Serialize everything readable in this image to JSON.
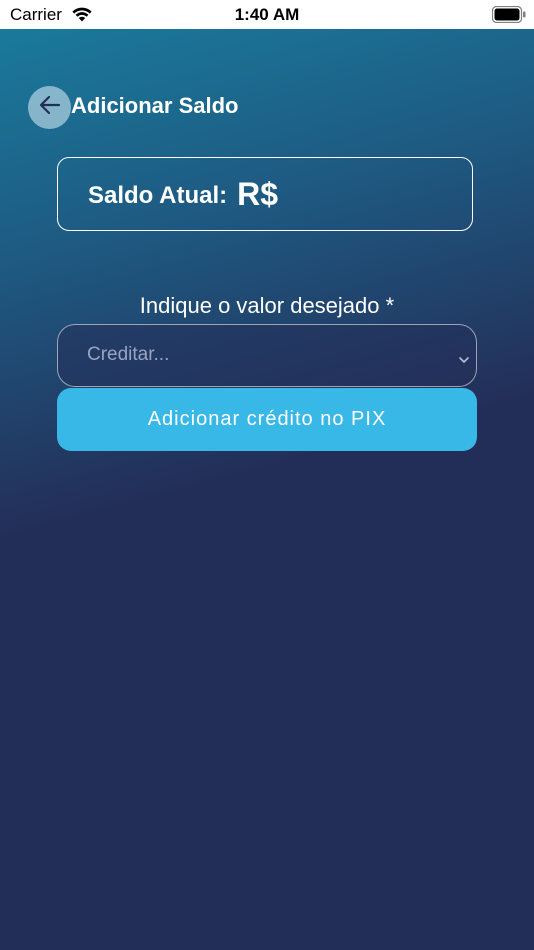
{
  "status_bar": {
    "carrier": "Carrier",
    "time": "1:40 AM",
    "wifi_icon": "wifi-icon",
    "battery_icon": "battery-icon"
  },
  "header": {
    "back_icon": "arrow-left-icon",
    "title": "Adicionar Saldo"
  },
  "balance": {
    "label": "Saldo Atual:",
    "value": "R$"
  },
  "form": {
    "field_label": "Indique o valor desejado *",
    "select_placeholder": "Creditar...",
    "select_icon": "chevron-down-icon",
    "submit_label": "Adicionar crédito no PIX"
  },
  "colors": {
    "gradient_top": "#1a7a9c",
    "background": "#232e58",
    "button": "#38b8e6",
    "text": "#ffffff"
  }
}
